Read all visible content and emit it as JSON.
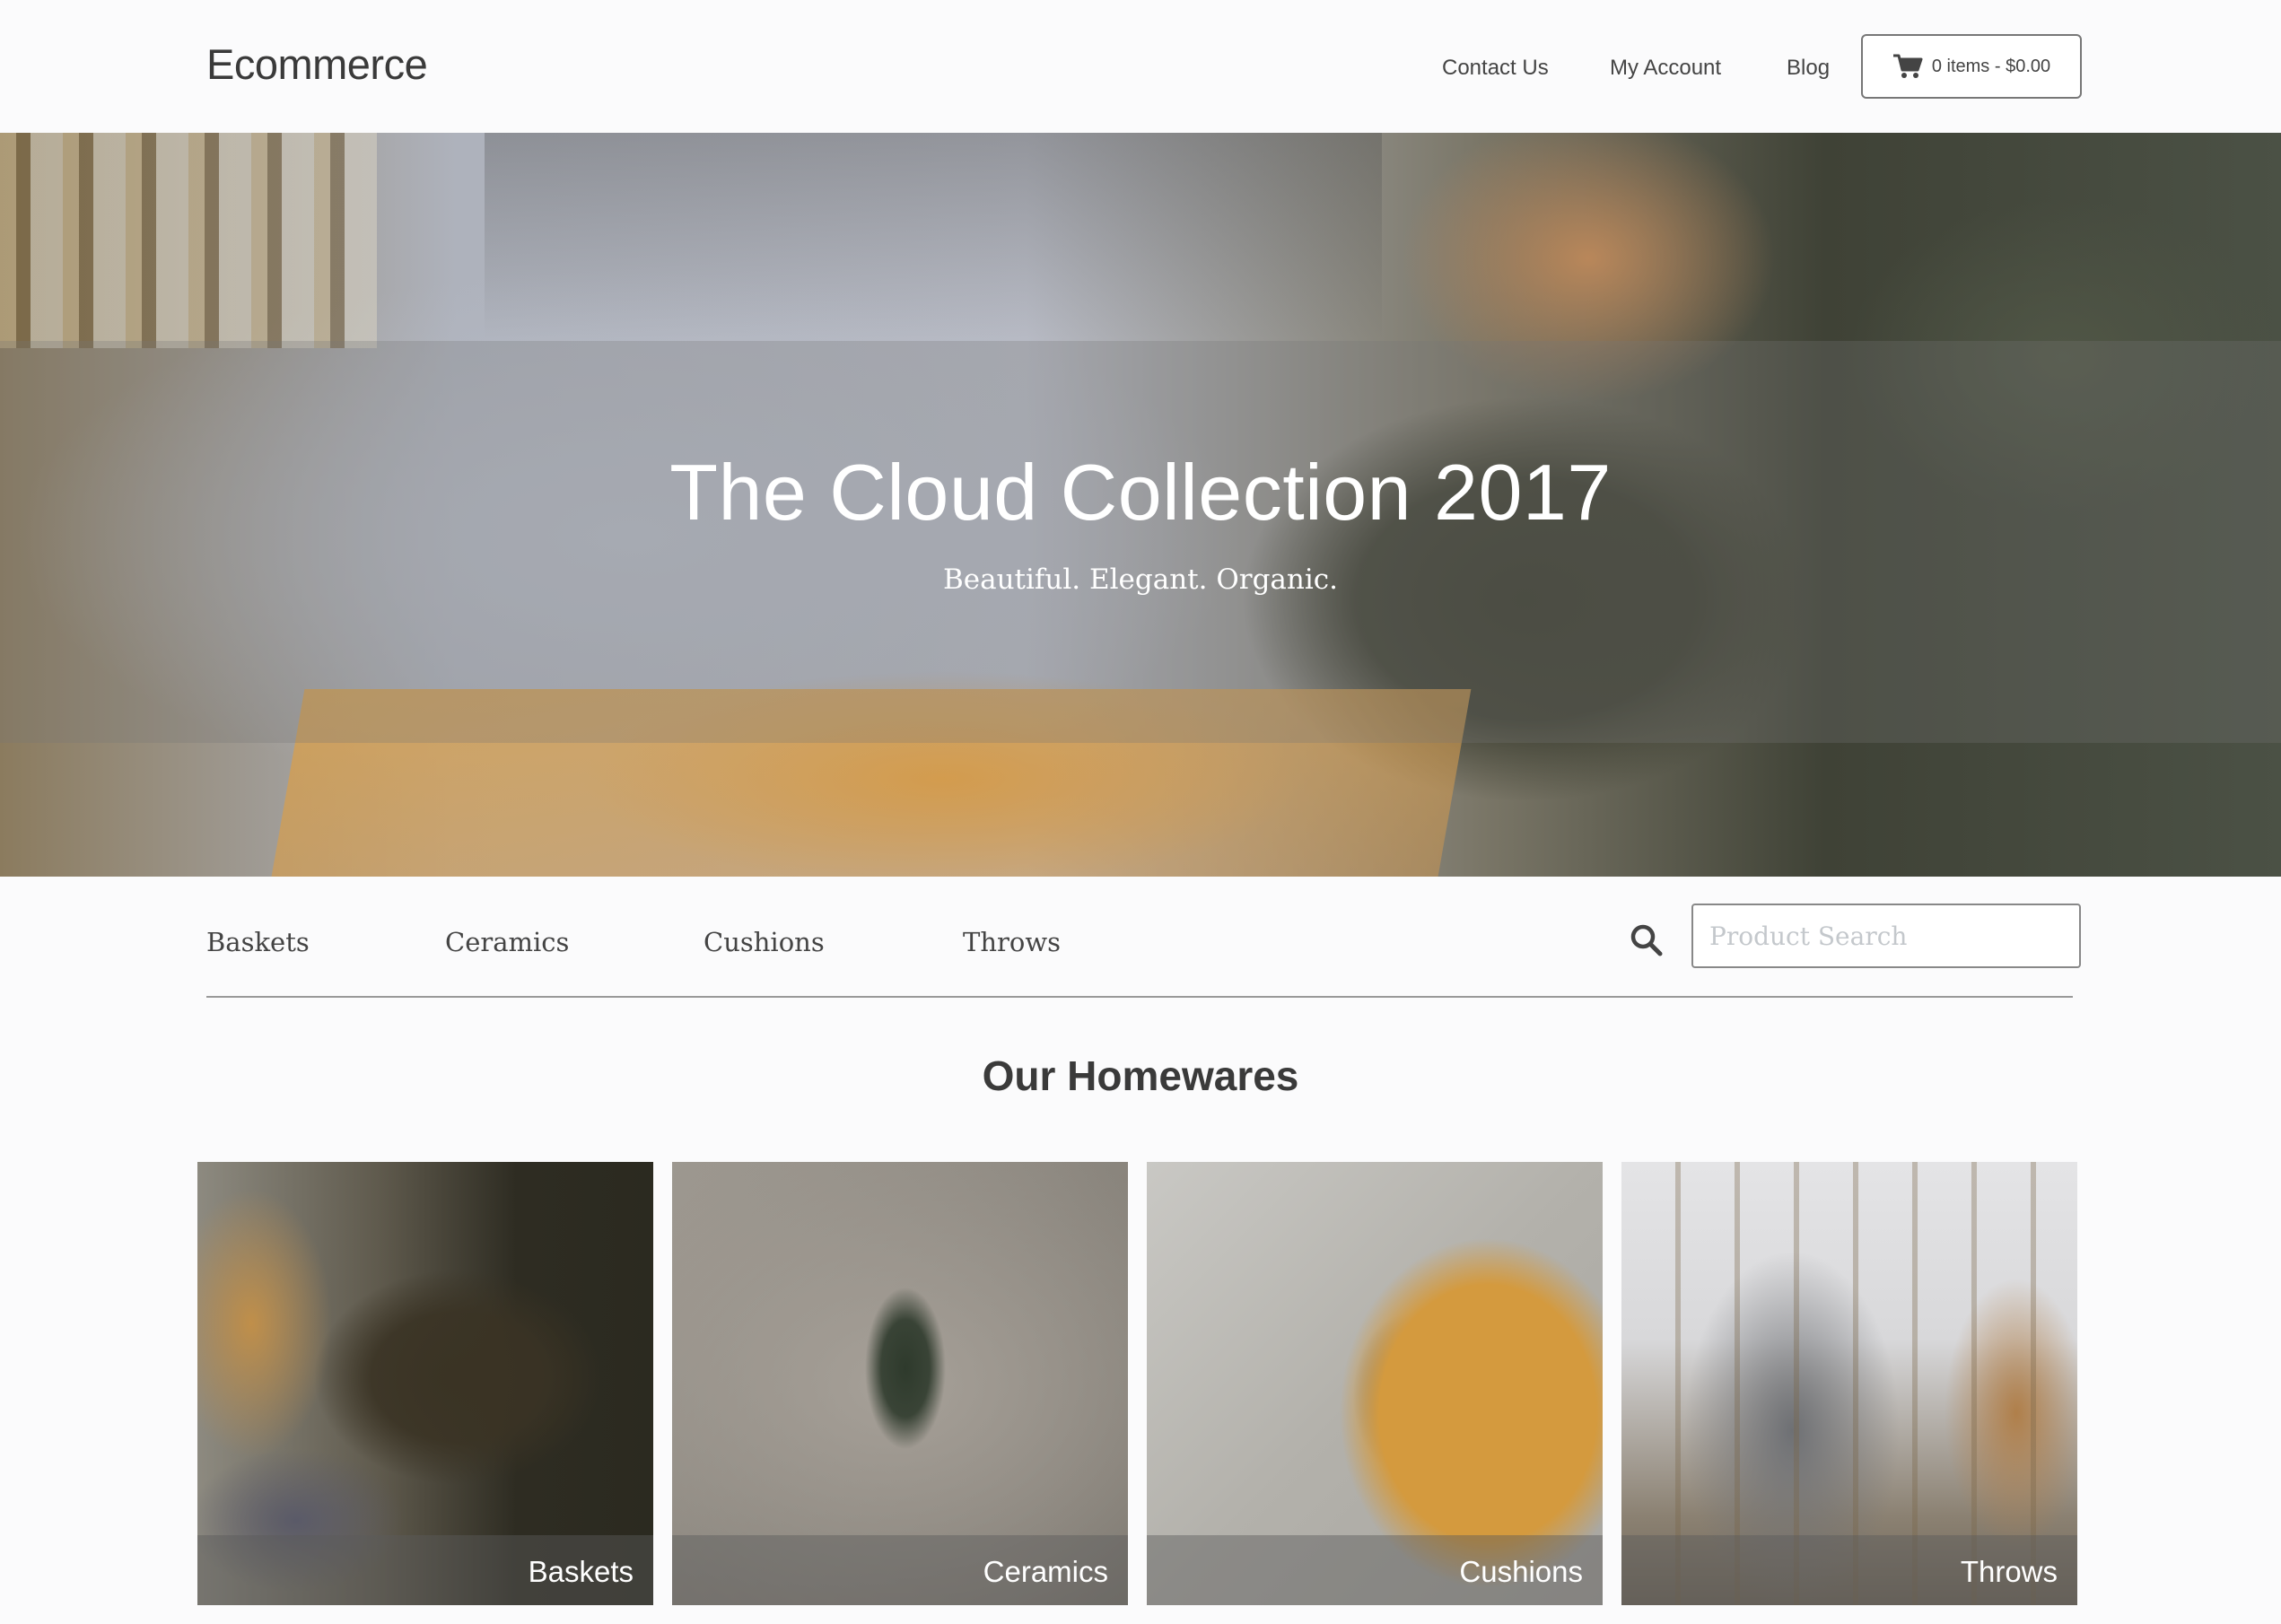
{
  "header": {
    "logo": "Ecommerce",
    "nav": [
      "Contact Us",
      "My Account",
      "Blog"
    ],
    "cart": {
      "label": "0 items - $0.00",
      "icon": "cart-icon"
    }
  },
  "hero": {
    "title": "The Cloud Collection 2017",
    "subtitle": "Beautiful. Elegant. Organic."
  },
  "categories": [
    "Baskets",
    "Ceramics",
    "Cushions",
    "Throws"
  ],
  "search": {
    "placeholder": "Product Search",
    "value": "",
    "icon": "search-icon"
  },
  "section": {
    "title": "Our Homewares"
  },
  "products": [
    {
      "label": "Baskets"
    },
    {
      "label": "Ceramics"
    },
    {
      "label": "Cushions"
    },
    {
      "label": "Throws"
    }
  ]
}
